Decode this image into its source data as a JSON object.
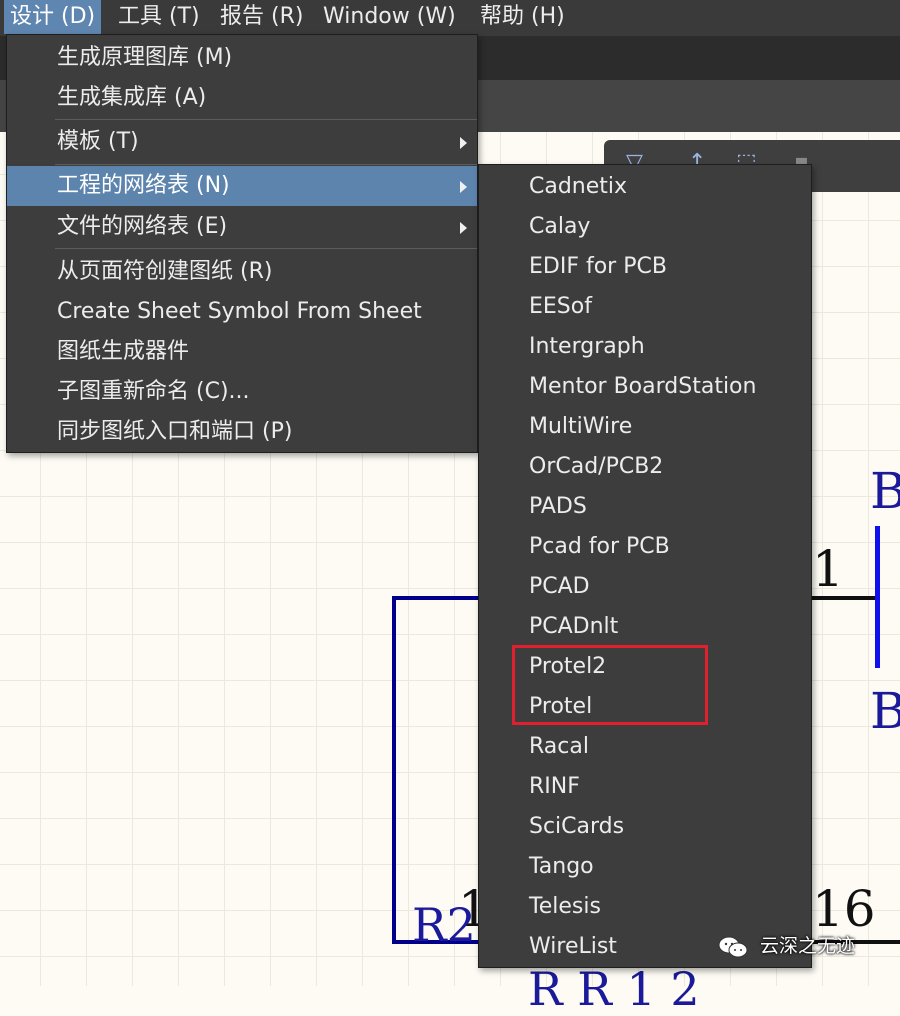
{
  "menubar": {
    "items": [
      {
        "label": "设计 (D)"
      },
      {
        "label": "工具 (T)"
      },
      {
        "label": "报告 (R)"
      },
      {
        "label": "Window (W)"
      },
      {
        "label": "帮助 (H)"
      }
    ]
  },
  "design_menu": {
    "items": [
      {
        "label": "生成原理图库 (M)",
        "submenu": false
      },
      {
        "label": "生成集成库 (A)",
        "submenu": false
      },
      {
        "label": "模板 (T)",
        "submenu": true
      },
      {
        "label": "工程的网络表 (N)",
        "submenu": true,
        "highlighted": true
      },
      {
        "label": "文件的网络表 (E)",
        "submenu": true
      },
      {
        "label": "从页面符创建图纸 (R)",
        "submenu": false
      },
      {
        "label": "Create Sheet Symbol From Sheet",
        "submenu": false
      },
      {
        "label": "图纸生成器件",
        "submenu": false
      },
      {
        "label": "子图重新命名 (C)...",
        "submenu": false
      },
      {
        "label": "同步图纸入口和端口 (P)",
        "submenu": false
      }
    ]
  },
  "netlist_submenu": {
    "items": [
      {
        "label": "Cadnetix"
      },
      {
        "label": "Calay"
      },
      {
        "label": "EDIF for PCB"
      },
      {
        "label": "EESof"
      },
      {
        "label": "Intergraph"
      },
      {
        "label": "Mentor BoardStation"
      },
      {
        "label": "MultiWire"
      },
      {
        "label": "OrCad/PCB2"
      },
      {
        "label": "PADS"
      },
      {
        "label": "Pcad for PCB"
      },
      {
        "label": "PCAD"
      },
      {
        "label": "PCADnlt"
      },
      {
        "label": "Protel2"
      },
      {
        "label": "Protel"
      },
      {
        "label": "Racal"
      },
      {
        "label": "RINF"
      },
      {
        "label": "SciCards"
      },
      {
        "label": "Tango"
      },
      {
        "label": "Telesis"
      },
      {
        "label": "WireList"
      }
    ]
  },
  "schematic": {
    "labels": {
      "b_top": "B",
      "b_mid": "B",
      "pin_1": "1",
      "pin_16": "16",
      "pin_1b": "1",
      "r2": "R2",
      "bottom_partial": "R   R   1 2"
    }
  },
  "watermark": {
    "text": "云深之无迹"
  },
  "colors": {
    "menu_bg": "#3d3d3d",
    "highlight": "#5c84ad",
    "annotation_red": "#e0202e",
    "schematic_blue": "#00008a"
  }
}
